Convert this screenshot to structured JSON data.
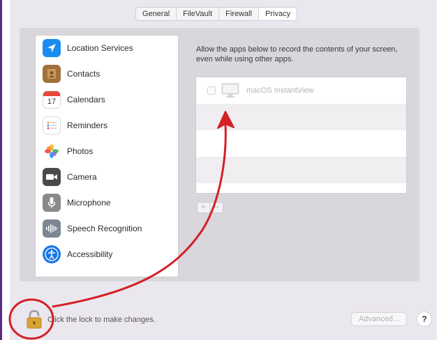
{
  "tabs": [
    {
      "label": "General",
      "active": false
    },
    {
      "label": "FileVault",
      "active": false
    },
    {
      "label": "Firewall",
      "active": false
    },
    {
      "label": "Privacy",
      "active": true
    }
  ],
  "sidebar": {
    "items": [
      {
        "label": "Location Services",
        "icon": "location-arrow-icon"
      },
      {
        "label": "Contacts",
        "icon": "contacts-book-icon"
      },
      {
        "label": "Calendars",
        "icon": "calendar-icon",
        "icon_text": "17"
      },
      {
        "label": "Reminders",
        "icon": "reminders-list-icon"
      },
      {
        "label": "Photos",
        "icon": "photos-flower-icon"
      },
      {
        "label": "Camera",
        "icon": "camera-icon"
      },
      {
        "label": "Microphone",
        "icon": "microphone-icon"
      },
      {
        "label": "Speech Recognition",
        "icon": "waveform-icon"
      },
      {
        "label": "Accessibility",
        "icon": "accessibility-person-icon"
      }
    ]
  },
  "main": {
    "description": "Allow the apps below to record the contents of your screen, even while using other apps.",
    "apps": [
      {
        "name": "macOS InstantView",
        "checked": false,
        "icon": "monitor-icon"
      }
    ],
    "add_label": "+",
    "remove_label": "−"
  },
  "footer": {
    "lock_text": "Click the lock to make changes.",
    "advanced_label": "Advanced...",
    "help_label": "?"
  },
  "colors": {
    "annotation_red": "#d42027",
    "window_bg": "#ebe7ee",
    "content_bg": "#d9d6dc",
    "accent_purple": "#5a2c86"
  }
}
